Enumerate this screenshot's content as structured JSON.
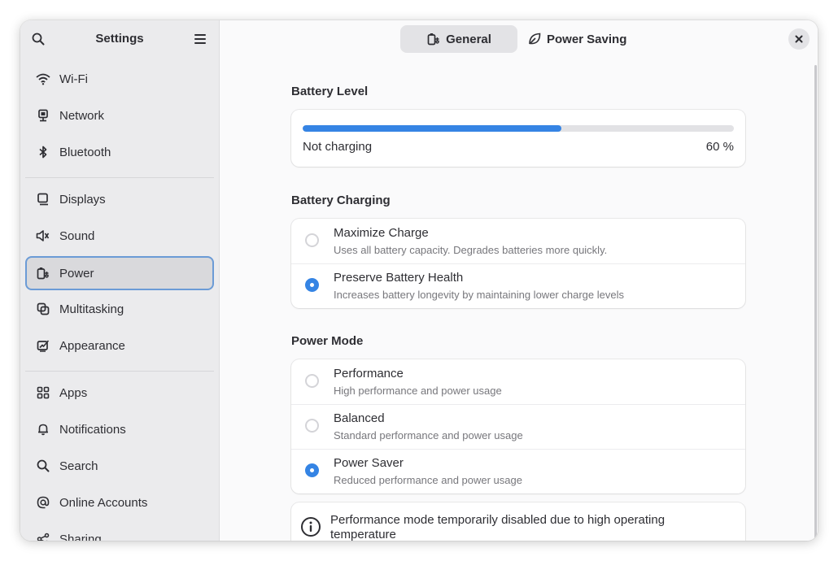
{
  "sidebar": {
    "title": "Settings",
    "search_icon": "search-icon",
    "menu_icon": "hamburger-menu-icon",
    "items": [
      {
        "label": "Wi-Fi",
        "icon": "wifi-icon"
      },
      {
        "label": "Network",
        "icon": "network-icon"
      },
      {
        "label": "Bluetooth",
        "icon": "bluetooth-icon"
      },
      {
        "label": "Displays",
        "icon": "display-icon"
      },
      {
        "label": "Sound",
        "icon": "speaker-icon"
      },
      {
        "label": "Power",
        "icon": "battery-plug-icon",
        "active": true
      },
      {
        "label": "Multitasking",
        "icon": "multitasking-icon"
      },
      {
        "label": "Appearance",
        "icon": "appearance-icon"
      },
      {
        "label": "Apps",
        "icon": "apps-grid-icon"
      },
      {
        "label": "Notifications",
        "icon": "bell-icon"
      },
      {
        "label": "Search",
        "icon": "search-icon"
      },
      {
        "label": "Online Accounts",
        "icon": "at-icon"
      },
      {
        "label": "Sharing",
        "icon": "share-icon"
      }
    ]
  },
  "tabs": [
    {
      "label": "General",
      "icon": "battery-plug-icon",
      "active": true
    },
    {
      "label": "Power Saving",
      "icon": "leaf-icon",
      "active": false
    }
  ],
  "close_icon": "close-icon",
  "battery": {
    "section_title": "Battery Level",
    "level_percent": 60,
    "status": "Not charging",
    "percent_label": "60 %"
  },
  "charging": {
    "section_title": "Battery Charging",
    "options": [
      {
        "title": "Maximize Charge",
        "subtitle": "Uses all battery capacity. Degrades batteries more quickly.",
        "selected": false
      },
      {
        "title": "Preserve Battery Health",
        "subtitle": "Increases battery longevity by maintaining lower charge levels",
        "selected": true
      }
    ]
  },
  "power_mode": {
    "section_title": "Power Mode",
    "options": [
      {
        "title": "Performance",
        "subtitle": "High performance and power usage",
        "selected": false
      },
      {
        "title": "Balanced",
        "subtitle": "Standard performance and power usage",
        "selected": false
      },
      {
        "title": "Power Saver",
        "subtitle": "Reduced performance and power usage",
        "selected": true
      }
    ]
  },
  "info": {
    "icon": "info-icon",
    "text": "Performance mode temporarily disabled due to high operating temperature"
  },
  "colors": {
    "accent": "#3584e4",
    "sidebar_bg": "#ebebed",
    "active_outline": "#6b9bd6"
  }
}
